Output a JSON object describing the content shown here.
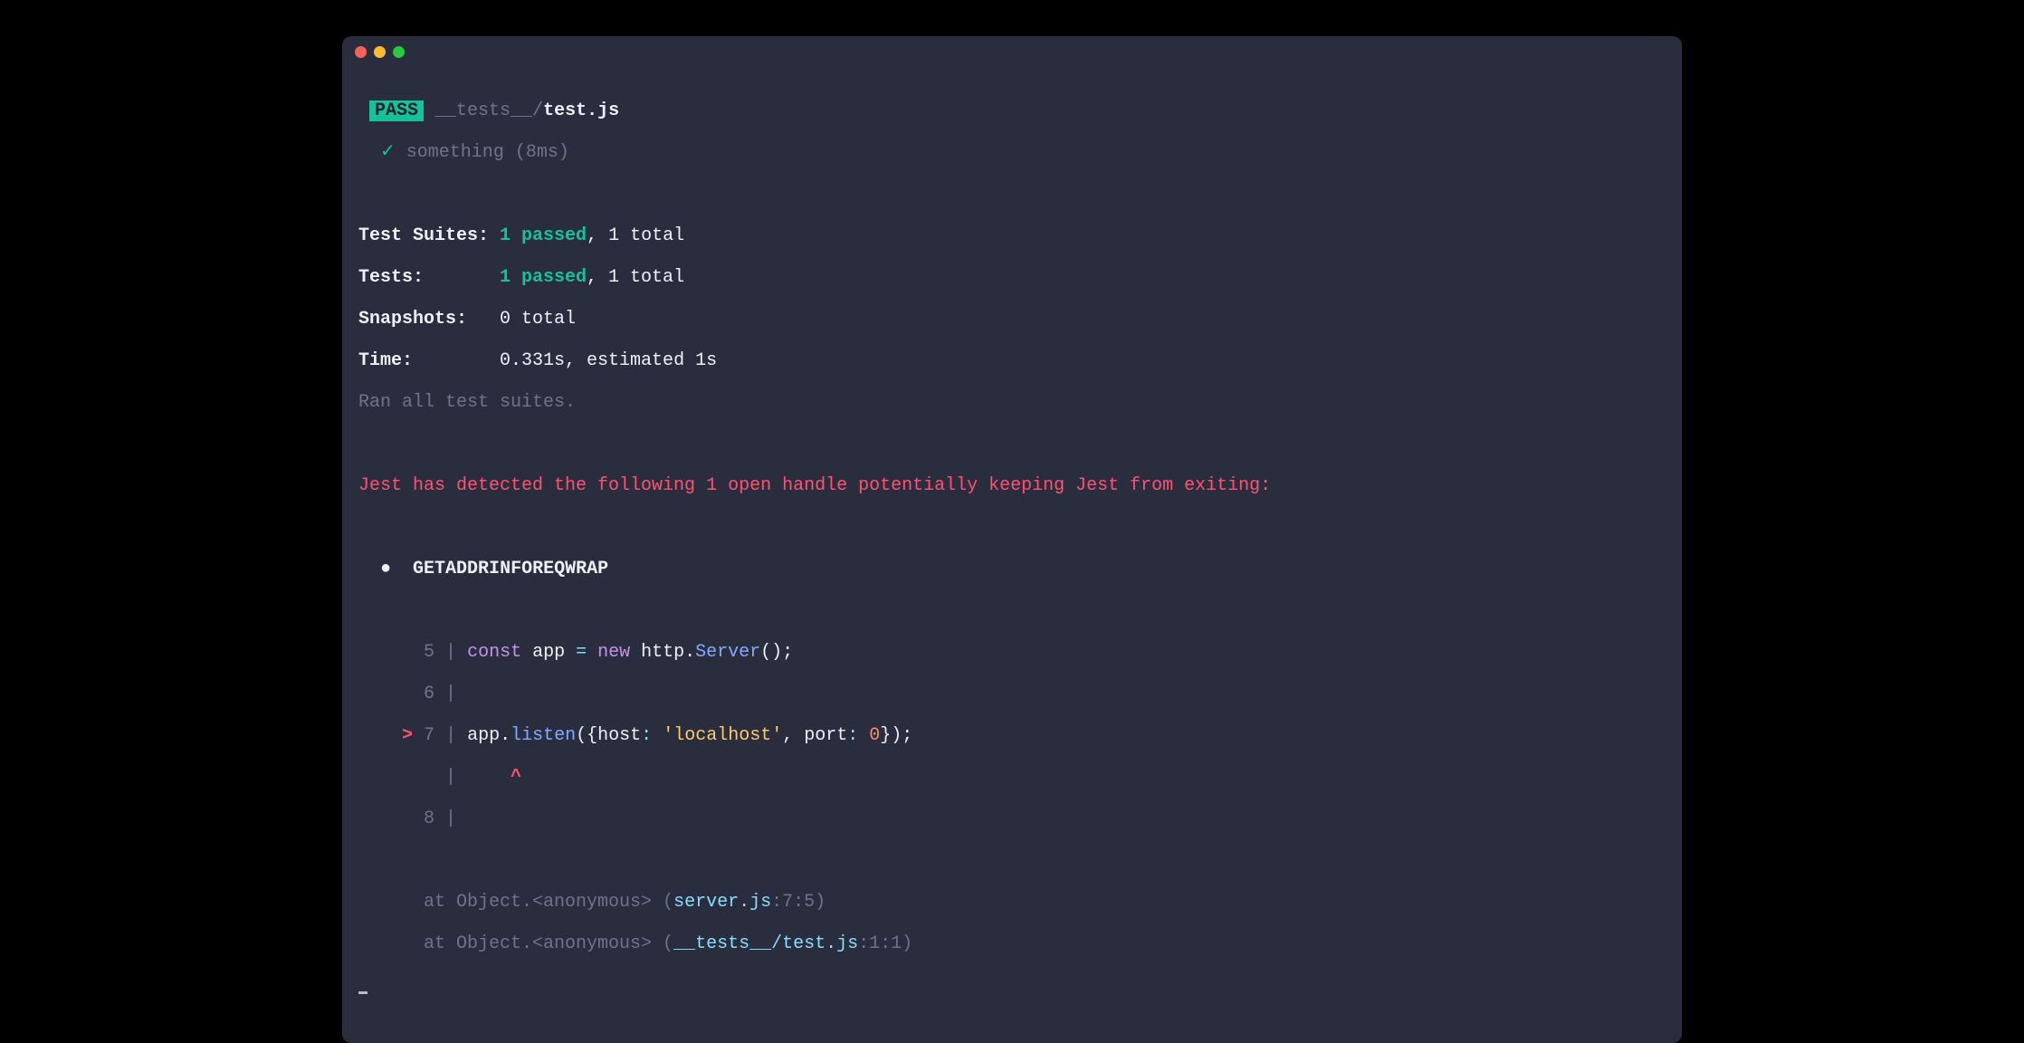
{
  "header": {
    "badge": "PASS",
    "path_dim": "__tests__/",
    "path_bold": "test.js",
    "check": "✓",
    "test_name": "something",
    "test_time": "(8ms)"
  },
  "summary": {
    "suites_label": "Test Suites:",
    "suites_passed": "1 passed",
    "suites_total": ", 1 total",
    "tests_label": "Tests:",
    "tests_passed": "1 passed",
    "tests_total": ", 1 total",
    "snapshots_label": "Snapshots:",
    "snapshots_value": "0 total",
    "time_label": "Time:",
    "time_value": "0.331s, estimated 1s",
    "ran": "Ran all test suites."
  },
  "warning": {
    "message": "Jest has detected the following 1 open handle potentially keeping Jest from exiting:",
    "bullet": "●",
    "handle": "GETADDRINFOREQWRAP"
  },
  "code": {
    "l5": {
      "num": "5",
      "kw_const": "const",
      "var_app": " app ",
      "op_eq": "=",
      "kw_new": " new",
      "rest": " http.",
      "fn": "Server",
      "rest2": "();"
    },
    "l6": {
      "num": "6"
    },
    "l7": {
      "marker": ">",
      "num": "7",
      "obj": "app.",
      "fn": "listen",
      "open": "({",
      "key1": "host",
      "colon1": ": ",
      "val1": "'localhost'",
      "comma": ", ",
      "key2": "port",
      "colon2": ": ",
      "val2": "0",
      "close": "});"
    },
    "caret": "^",
    "l8": {
      "num": "8"
    }
  },
  "stack": {
    "at1_pre": "at Object.<anonymous> (",
    "at1_file": "server.js",
    "at1_loc": ":7:5)",
    "at2_pre": "at Object.<anonymous> (",
    "at2_file": "__tests__/test.js",
    "at2_loc": ":1:1)"
  }
}
